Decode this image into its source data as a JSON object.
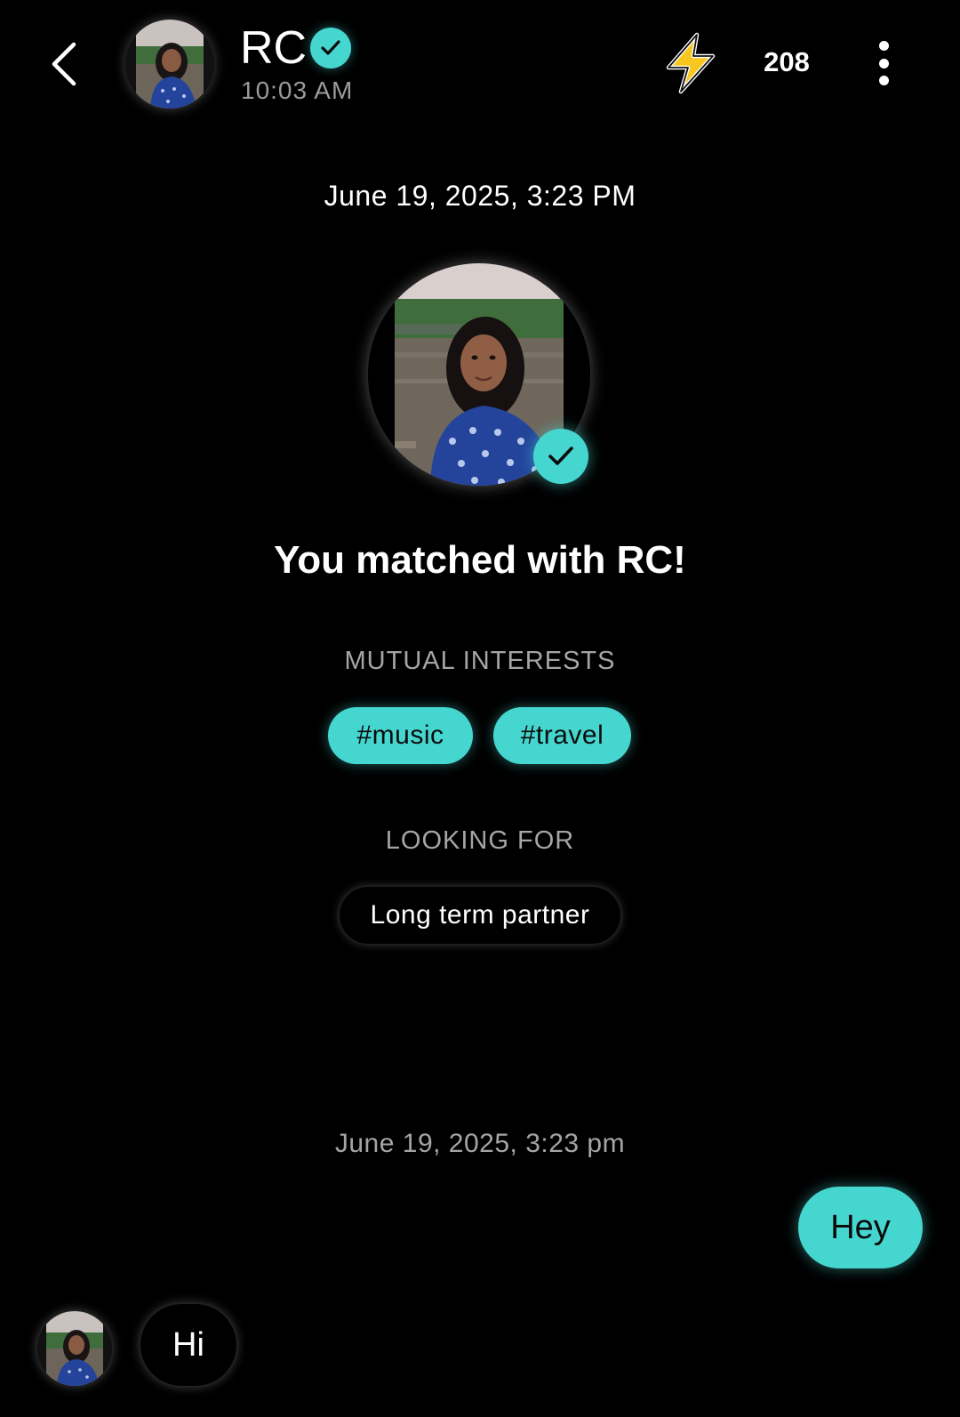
{
  "header": {
    "name": "RC",
    "time": "10:03 AM",
    "boost_count": "208",
    "icons": {
      "back": "chevron-left-icon",
      "verified": "check-badge-icon",
      "boost": "lightning-icon",
      "more": "more-vertical-icon"
    }
  },
  "match": {
    "date": "June 19, 2025, 3:23 PM",
    "title": "You matched with RC!",
    "mutual_interests_label": "MUTUAL INTERESTS",
    "interests": [
      "#music",
      "#travel"
    ],
    "looking_for_label": "LOOKING FOR",
    "looking_for": "Long term partner"
  },
  "messages": {
    "date": "June 19, 2025, 3:23 pm",
    "sent": "Hey",
    "received": "Hi"
  },
  "colors": {
    "background": "#000000",
    "accent": "#46d6d0",
    "boost_yellow": "#f7c71f",
    "muted_text": "#a5a5a5"
  }
}
